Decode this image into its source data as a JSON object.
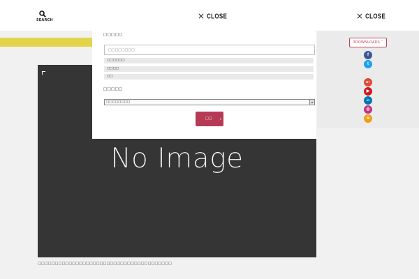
{
  "header": {
    "search_label": "SEARCH",
    "close_label_1": "CLOSE",
    "close_label_2": "CLOSE"
  },
  "search_panel": {
    "heading_keyword": "□□□□□",
    "search_placeholder": "□□□□□□□□",
    "options": [
      "□□□□□□",
      "□□□□",
      "□□"
    ],
    "heading_category": "□□□□□",
    "select_value": "□□□□□□□□",
    "submit_label": "□□"
  },
  "main": {
    "image_text": "No Image",
    "caption": "□□□□□□□□□□□□□□□□□□□□□□□□□□□□□□□□□□□□□□□"
  },
  "share_panel": {
    "download_label": "3DOWNLOADS ˅",
    "icons": [
      {
        "name": "facebook-icon",
        "glyph": "f",
        "color": "#3b5998"
      },
      {
        "name": "twitter-icon",
        "glyph": "t",
        "color": "#1da1f2"
      },
      {
        "name": "google-plus-icon",
        "glyph": "G+",
        "color": "#dd4b39"
      },
      {
        "name": "youtube-icon",
        "glyph": "▶",
        "color": "#cc181e"
      },
      {
        "name": "linkedin-icon",
        "glyph": "in",
        "color": "#0077b5"
      },
      {
        "name": "instagram-icon",
        "glyph": "◎",
        "color": "#c13584"
      },
      {
        "name": "rss-icon",
        "glyph": "≋",
        "color": "#f39c12"
      }
    ]
  },
  "colors": {
    "accent_yellow": "#e4d44b",
    "submit_red": "#b63a55",
    "image_bg": "#353535"
  }
}
